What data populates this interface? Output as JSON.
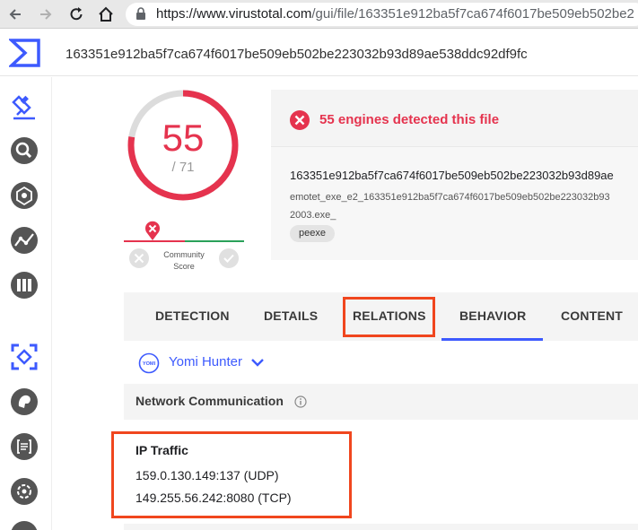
{
  "browser": {
    "url_host": "https://www.virustotal.com",
    "url_path": "/gui/file/163351e912ba5f7ca674f6017be509eb502be2"
  },
  "header": {
    "hash": "163351e912ba5f7ca674f6017be509eb502be223032b93d89ae538ddc92df9fc"
  },
  "score": {
    "detected": "55",
    "total": "/ 71",
    "community_label_1": "Community",
    "community_label_2": "Score",
    "detection_fraction": 0.775
  },
  "detection": {
    "message": "55 engines detected this file",
    "file_hash": "163351e912ba5f7ca674f6017be509eb502be223032b93d89ae",
    "file_name_line1": "emotet_exe_e2_163351e912ba5f7ca674f6017be509eb502be223032b93",
    "file_name_line2": "2003.exe_",
    "tag": "peexe"
  },
  "tabs": {
    "detection": "DETECTION",
    "details": "DETAILS",
    "relations": "RELATIONS",
    "behavior": "BEHAVIOR",
    "content": "CONTENT",
    "active": "BEHAVIOR"
  },
  "sandbox": {
    "selected": "Yomi Hunter",
    "icon_text": "YOMI"
  },
  "network": {
    "title": "Network Communication",
    "ip_traffic_title": "IP Traffic",
    "ip_traffic": [
      "159.0.130.149:137 (UDP)",
      "149.255.56.242:8080 (TCP)"
    ]
  },
  "colors": {
    "brand": "#3d5afe",
    "malicious": "#e5334e",
    "harmless": "#2aa15a",
    "highlight": "#f0461e"
  }
}
